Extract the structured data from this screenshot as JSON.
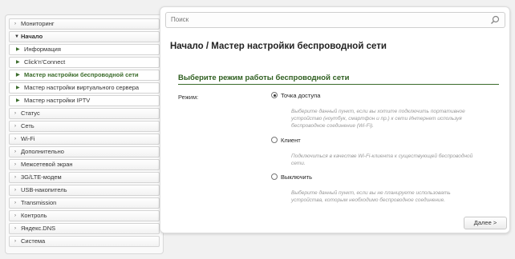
{
  "sidebar": {
    "items": [
      {
        "label": "Мониторинг",
        "type": "top",
        "arrow": "›"
      },
      {
        "label": "Начало",
        "type": "open",
        "arrow": "⌄"
      },
      {
        "label": "Информация",
        "type": "sub"
      },
      {
        "label": "Click'n'Connect",
        "type": "sub"
      },
      {
        "label": "Мастер настройки беспроводной сети",
        "type": "sub-active"
      },
      {
        "label": "Мастер настройки виртуального сервера",
        "type": "sub"
      },
      {
        "label": "Мастер настройки IPTV",
        "type": "sub"
      },
      {
        "label": "Статус",
        "type": "top",
        "arrow": "›"
      },
      {
        "label": "Сеть",
        "type": "top",
        "arrow": "›"
      },
      {
        "label": "Wi-Fi",
        "type": "top",
        "arrow": "›"
      },
      {
        "label": "Дополнительно",
        "type": "top",
        "arrow": "›"
      },
      {
        "label": "Межсетевой экран",
        "type": "top",
        "arrow": "›"
      },
      {
        "label": "3G/LTE-модем",
        "type": "top",
        "arrow": "›"
      },
      {
        "label": "USB-накопитель",
        "type": "top",
        "arrow": "›"
      },
      {
        "label": "Transmission",
        "type": "top",
        "arrow": "›"
      },
      {
        "label": "Контроль",
        "type": "top",
        "arrow": "›"
      },
      {
        "label": "Яндекс.DNS",
        "type": "top",
        "arrow": "›"
      },
      {
        "label": "Система",
        "type": "top",
        "arrow": "›"
      }
    ]
  },
  "search": {
    "placeholder": "Поиск",
    "icon": "search-icon"
  },
  "breadcrumb": "Начало /  Мастер настройки беспроводной сети",
  "section": {
    "title": "Выберите режим работы беспроводной сети"
  },
  "mode": {
    "label": "Режим:",
    "options": [
      {
        "label": "Точка доступа",
        "checked": true,
        "description": "Выберите данный пункт, если вы хотите подключить портативное устройство (ноутбук, смартфон и пр.) к сети Интернет используя беспроводное соединение (Wi-Fi)."
      },
      {
        "label": "Клиент",
        "checked": false,
        "description": "Подключиться в качестве Wi-Fi-клиента к существующей беспроводной сети."
      },
      {
        "label": "Выключить",
        "checked": false,
        "description": "Выберите данный пункт, если вы не планируете использовать устройства, которым необходимо беспроводное соединение."
      }
    ]
  },
  "buttons": {
    "next": "Далее >"
  },
  "colors": {
    "accent": "#3a6b2a",
    "panel_bg": "#ffffff",
    "page_bg": "#f1f1f1"
  }
}
